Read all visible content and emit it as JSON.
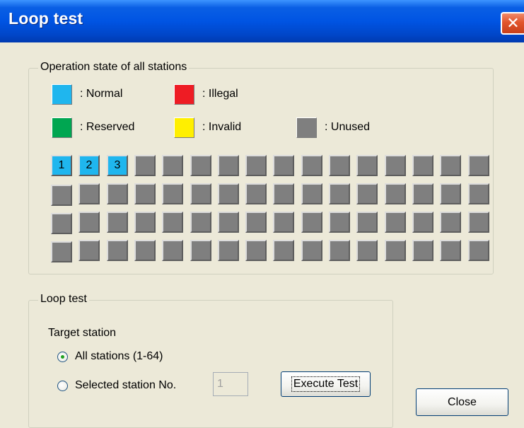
{
  "window": {
    "title": "Loop test",
    "close_glyph": "✕"
  },
  "operation_state": {
    "legend": "Operation state of all stations",
    "key": [
      {
        "label": ": Normal",
        "color": "#1fb6ee"
      },
      {
        "label": ": Illegal",
        "color": "#ee1c24"
      },
      {
        "label": ": Reserved",
        "color": "#00a651"
      },
      {
        "label": ": Invalid",
        "color": "#ffef00"
      },
      {
        "label": ": Unused",
        "color": "#7f7f7f"
      }
    ],
    "grid_rows": 4,
    "grid_cols": 16,
    "stations": [
      {
        "number": "1",
        "state": "Normal"
      },
      {
        "number": "2",
        "state": "Normal"
      },
      {
        "number": "3",
        "state": "Normal"
      }
    ],
    "other_stations_state": "Unused"
  },
  "loop_test": {
    "legend": "Loop test",
    "target_station_label": "Target station",
    "option_all": "All stations (1-64)",
    "option_selected": "Selected station No.",
    "selected_option": "all",
    "station_input_value": "1",
    "execute_button": "Execute Test"
  },
  "close_button": "Close"
}
